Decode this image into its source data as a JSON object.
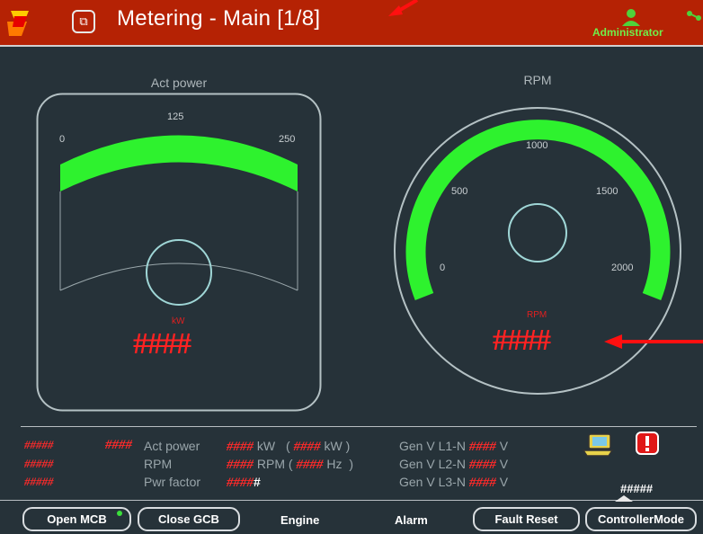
{
  "header": {
    "title": "Metering - Main [1/8]",
    "user": "Administrator"
  },
  "gauge_power": {
    "label": "Act power",
    "ticks": [
      "0",
      "125",
      "250"
    ],
    "unit": "kW",
    "value": "####"
  },
  "gauge_rpm": {
    "label": "RPM",
    "ticks": [
      "0",
      "500",
      "1000",
      "1500",
      "2000"
    ],
    "unit": "RPM",
    "value": "####"
  },
  "data": {
    "col1": [
      "#####",
      "#####",
      "#####"
    ],
    "col2_value": "####",
    "labels": [
      "Act power",
      "RPM",
      "Pwr factor"
    ],
    "row1": {
      "v1": "####",
      "u1": "kW",
      "open": "(",
      "v2": "####",
      "u2": "kW",
      "close": ")"
    },
    "row2": {
      "v1": "####",
      "u1": "RPM",
      "open": "(",
      "v2": "####",
      "u2": "Hz",
      "close": ")"
    },
    "row3": {
      "v1": "####",
      "suffix": "#"
    },
    "gen": [
      {
        "label": "Gen V L1-N",
        "value": "####",
        "unit": "V"
      },
      {
        "label": "Gen V L2-N",
        "value": "####",
        "unit": "V"
      },
      {
        "label": "Gen V L3-N",
        "value": "####",
        "unit": "V"
      }
    ],
    "mode_value": "#####"
  },
  "buttons": {
    "open_mcb": "Open MCB",
    "close_gcb": "Close GCB",
    "engine": "Engine",
    "alarm": "Alarm",
    "fault_reset": "Fault Reset",
    "controller_mode": "ControllerMode"
  },
  "colors": {
    "header": "#b52204",
    "background": "#263239",
    "gauge_arc": "#2ef22e",
    "alert_text": "#ff2a2a",
    "user_green": "#6ff04a"
  }
}
